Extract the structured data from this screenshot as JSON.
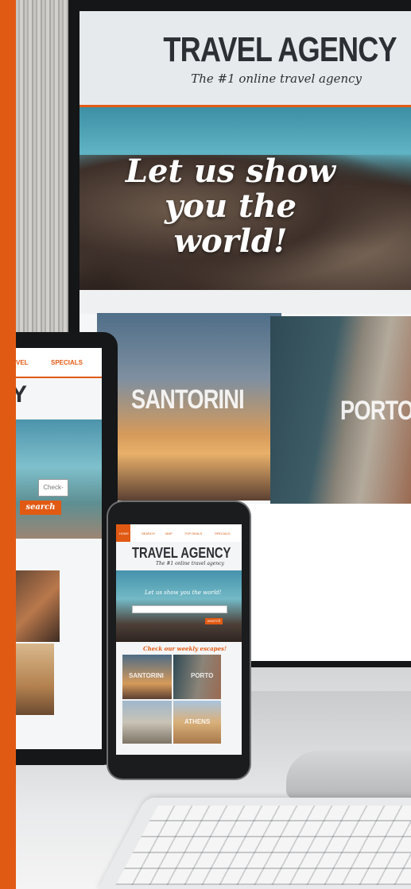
{
  "colors": {
    "accent": "#e15a13",
    "dark_text": "#2c2f33"
  },
  "monitor": {
    "title": "TRAVEL AGENCY",
    "subtitle": "The #1 online travel agency",
    "tagline_line1": "Let us show",
    "tagline_line2": "you the world!",
    "destinations": [
      "SANTORINI",
      "PORTO"
    ]
  },
  "tablet": {
    "nav_items": [
      "VEL",
      "SPECIALS"
    ],
    "title_fragment": "Y",
    "checkout_placeholder": "Check-out",
    "search_label": "search"
  },
  "phone": {
    "nav_items": [
      "HOME",
      "SEARCH",
      "MAP",
      "TOP DEALS",
      "SPECIALS"
    ],
    "title": "TRAVEL AGENCY",
    "subtitle": "The #1 online travel agency",
    "tagline": "Let us show you the world!",
    "search_label": "search",
    "deals_heading": "Check our weekly escapes!",
    "destinations": [
      "SANTORINI",
      "PORTO",
      "",
      "ATHENS"
    ]
  },
  "icons": {
    "keyboard": "keyboard-icon"
  }
}
